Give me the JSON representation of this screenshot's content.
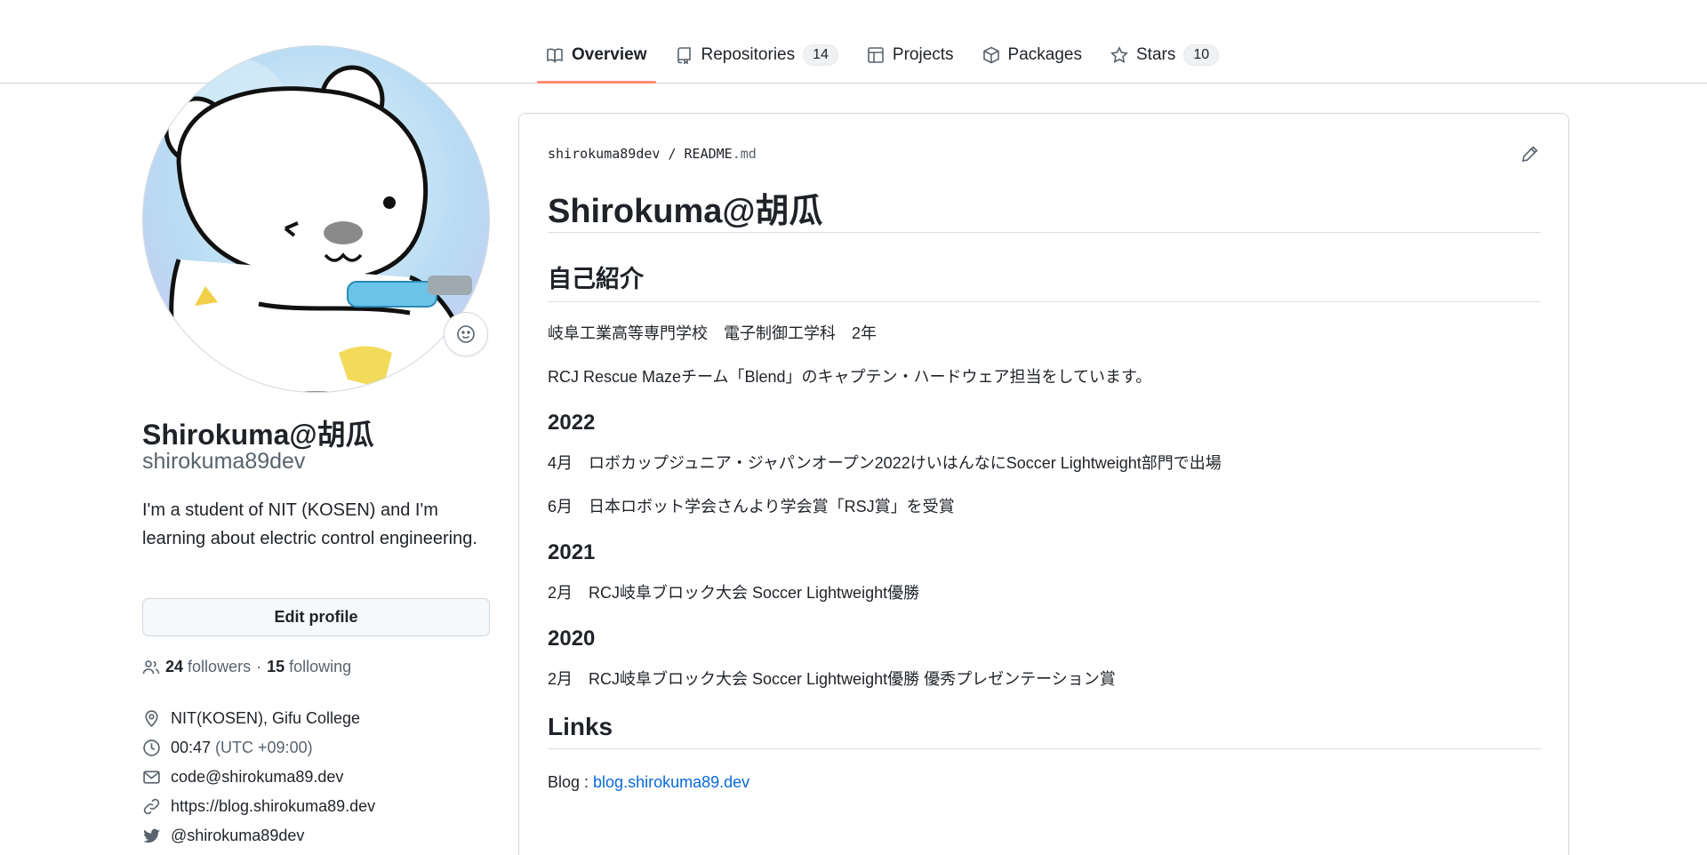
{
  "tabs": [
    {
      "label": "Overview",
      "icon": "book-icon",
      "active": true
    },
    {
      "label": "Repositories",
      "icon": "repo-icon",
      "count": "14"
    },
    {
      "label": "Projects",
      "icon": "table-icon"
    },
    {
      "label": "Packages",
      "icon": "package-icon"
    },
    {
      "label": "Stars",
      "icon": "star-icon",
      "count": "10"
    }
  ],
  "profile": {
    "avatar": "polar-bear-avatar",
    "name": "Shirokuma@胡瓜",
    "login": "shirokuma89dev",
    "bio": "I'm a student of NIT (KOSEN) and I'm learning about electric control engineering.",
    "edit_label": "Edit profile",
    "followers_count": "24",
    "followers_label": "followers",
    "separator": "·",
    "following_count": "15",
    "following_label": "following",
    "location": "NIT(KOSEN), Gifu College",
    "local_time": "00:47",
    "timezone": "(UTC +09:00)",
    "email": "code@shirokuma89.dev",
    "website": "https://blog.shirokuma89.dev",
    "twitter": "@shirokuma89dev"
  },
  "readme": {
    "owner": "shirokuma89dev",
    "sep": "/",
    "filename": "README",
    "ext": ".md",
    "title": "Shirokuma@胡瓜",
    "intro_heading": "自己紹介",
    "intro_lines": [
      "岐阜工業高等専門学校　電子制御工学科　2年",
      "RCJ Rescue Mazeチーム「Blend」のキャプテン・ハードウェア担当をしています。"
    ],
    "years": [
      {
        "year": "2022",
        "items": [
          "4月　ロボカップジュニア・ジャパンオープン2022けいはんなにSoccer Lightweight部門で出場",
          "6月　日本ロボット学会さんより学会賞「RSJ賞」を受賞"
        ]
      },
      {
        "year": "2021",
        "items": [
          "2月　RCJ岐阜ブロック大会 Soccer Lightweight優勝"
        ]
      },
      {
        "year": "2020",
        "items": [
          "2月　RCJ岐阜ブロック大会 Soccer Lightweight優勝 優秀プレゼンテーション賞"
        ]
      }
    ],
    "links_heading": "Links",
    "blog_label": "Blog : ",
    "blog_link": "blog.shirokuma89.dev"
  },
  "colors": {
    "accent_underline": "#fd8c73",
    "link": "#0969da",
    "muted": "#59636e"
  }
}
